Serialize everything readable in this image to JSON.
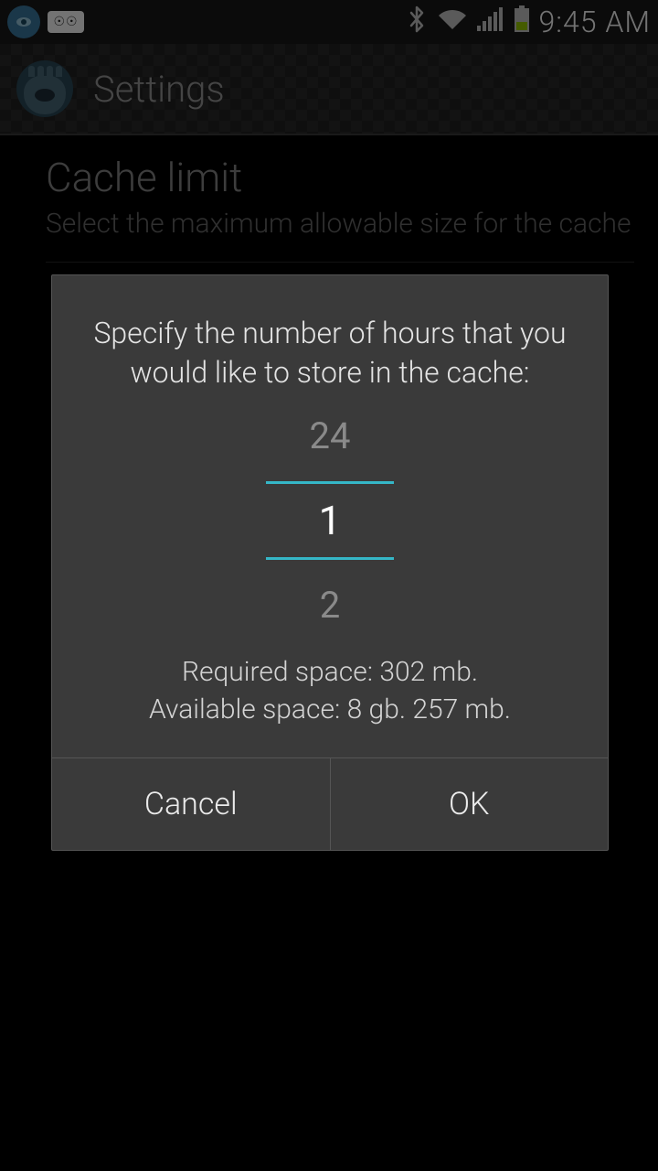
{
  "status": {
    "time": "9:45 AM",
    "icons": [
      "app-notification",
      "voicemail",
      "bluetooth",
      "wifi",
      "signal",
      "battery"
    ]
  },
  "header": {
    "title": "Settings"
  },
  "content": {
    "cache_limit": {
      "title": "Cache limit",
      "subtitle": "Select the maximum allowable size for the cache"
    }
  },
  "dialog": {
    "message": "Specify the number of hours that you would like to store in the cache:",
    "picker": {
      "prev": "24",
      "current": "1",
      "next": "2"
    },
    "required_space": "Required space: 302 mb.",
    "available_space": "Available space: 8 gb. 257 mb.",
    "buttons": {
      "cancel": "Cancel",
      "ok": "OK"
    }
  },
  "colors": {
    "accent": "#35b7c7",
    "dialog_bg": "#3a3a3a",
    "text_primary": "#e4e4e4",
    "text_secondary": "#8a8a8a"
  }
}
